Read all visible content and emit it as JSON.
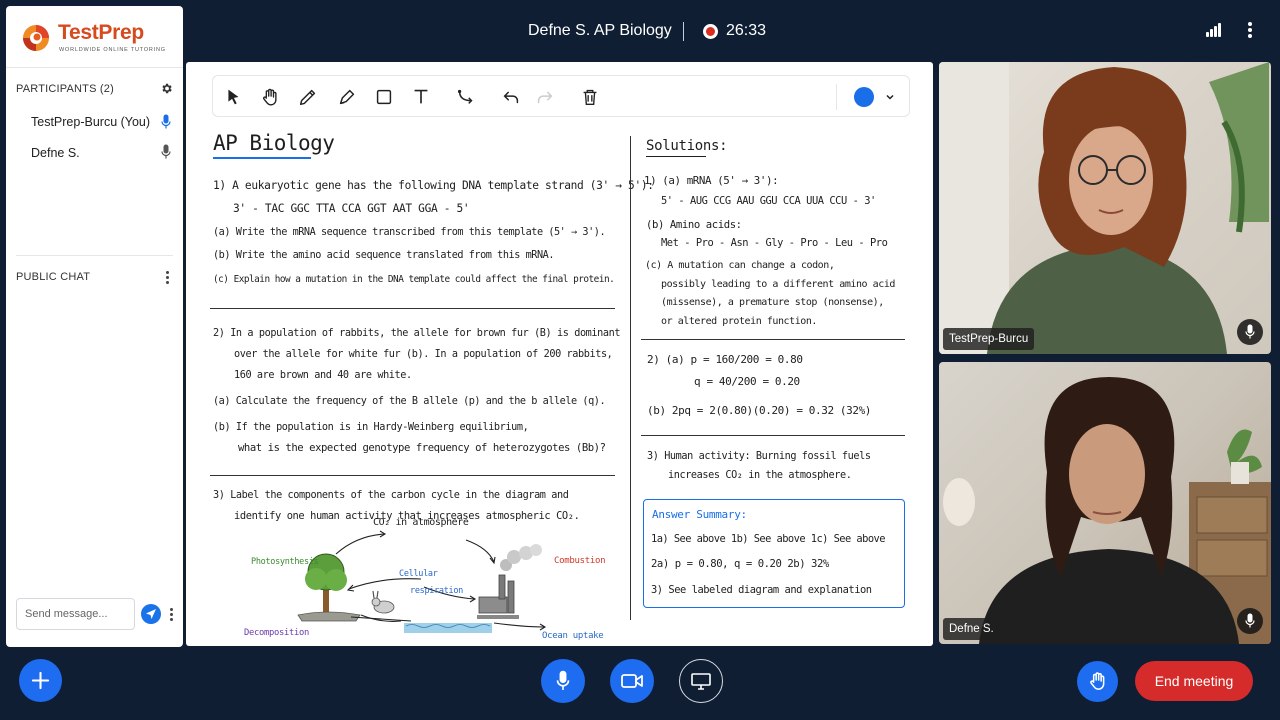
{
  "meeting": {
    "title": "Defne S. AP Biology",
    "timer": "26:33"
  },
  "brand": {
    "name": "TestPrep",
    "tagline": "WORLDWIDE ONLINE TUTORING"
  },
  "sidebar": {
    "participants_header": "PARTICIPANTS (2)",
    "participants": [
      {
        "name": "TestPrep-Burcu (You)",
        "mic": "active"
      },
      {
        "name": "Defne S.",
        "mic": "muted-style"
      }
    ],
    "chat_header": "PUBLIC CHAT",
    "chat_placeholder": "Send message..."
  },
  "whiteboard": {
    "active_color": "#1a6ee8",
    "title": "AP Biology",
    "questions": {
      "q1_stem": "1)  A eukaryotic gene has the following DNA template strand (3' → 5'):",
      "q1_strand": "3' - TAC GGC TTA CCA GGT AAT GGA - 5'",
      "q1_a": "(a)  Write the mRNA sequence transcribed from this template (5' → 3').",
      "q1_b": "(b)  Write the amino acid sequence translated from this mRNA.",
      "q1_c": "(c)  Explain how a mutation in the DNA template could affect the final protein.",
      "q2_line1": "2)  In a population of rabbits, the allele for brown fur (B) is dominant",
      "q2_line2": "over the allele for white fur (b). In a population of 200 rabbits,",
      "q2_line3": "160 are brown and 40 are white.",
      "q2_a": "(a)  Calculate the frequency of the B allele (p) and the b allele (q).",
      "q2_b1": "(b)  If the population is in Hardy-Weinberg equilibrium,",
      "q2_b2": "what is the expected genotype frequency of heterozygotes (Bb)?",
      "q3_line1": "3)  Label the components of the carbon cycle in the diagram and",
      "q3_line2": "identify one human activity that increases atmospheric CO₂."
    },
    "diagram": {
      "co2": "CO₂ in atmosphere",
      "photosynthesis": "Photosynthesis",
      "combustion": "Combustion",
      "cellular": "Cellular",
      "respiration": "respiration",
      "decomposition": "Decomposition",
      "ocean": "Ocean uptake"
    },
    "solutions": {
      "title": "Solutions:",
      "s1a": "1) (a)  mRNA (5' → 3'):",
      "s1a_seq": "5' - AUG CCG AAU GGU CCA UUA CCU - 3'",
      "s1b": "(b)  Amino acids:",
      "s1b_seq": "Met - Pro - Asn - Gly - Pro - Leu - Pro",
      "s1c_1": "(c)  A mutation can change a codon,",
      "s1c_2": "possibly leading to a different amino acid",
      "s1c_3": "(missense), a premature stop (nonsense),",
      "s1c_4": "or altered protein function.",
      "s2a_p": "2)  (a)   p = 160/200 = 0.80",
      "s2a_q": "q = 40/200 = 0.20",
      "s2b": "(b)  2pq  =  2(0.80)(0.20) = 0.32  (32%)",
      "s3_1": "3)  Human activity: Burning fossil fuels",
      "s3_2": "increases CO₂ in the atmosphere."
    },
    "summary": {
      "title": "Answer Summary:",
      "row1": "1a)  See above    1b)  See above    1c)  See above",
      "row2": "2a)  p = 0.80, q = 0.20      2b)  32%",
      "row3": "3)  See labeled diagram and explanation"
    }
  },
  "videos": [
    {
      "name": "TestPrep-Burcu"
    },
    {
      "name": "Defne S."
    }
  ],
  "controls": {
    "end_label": "End meeting"
  }
}
